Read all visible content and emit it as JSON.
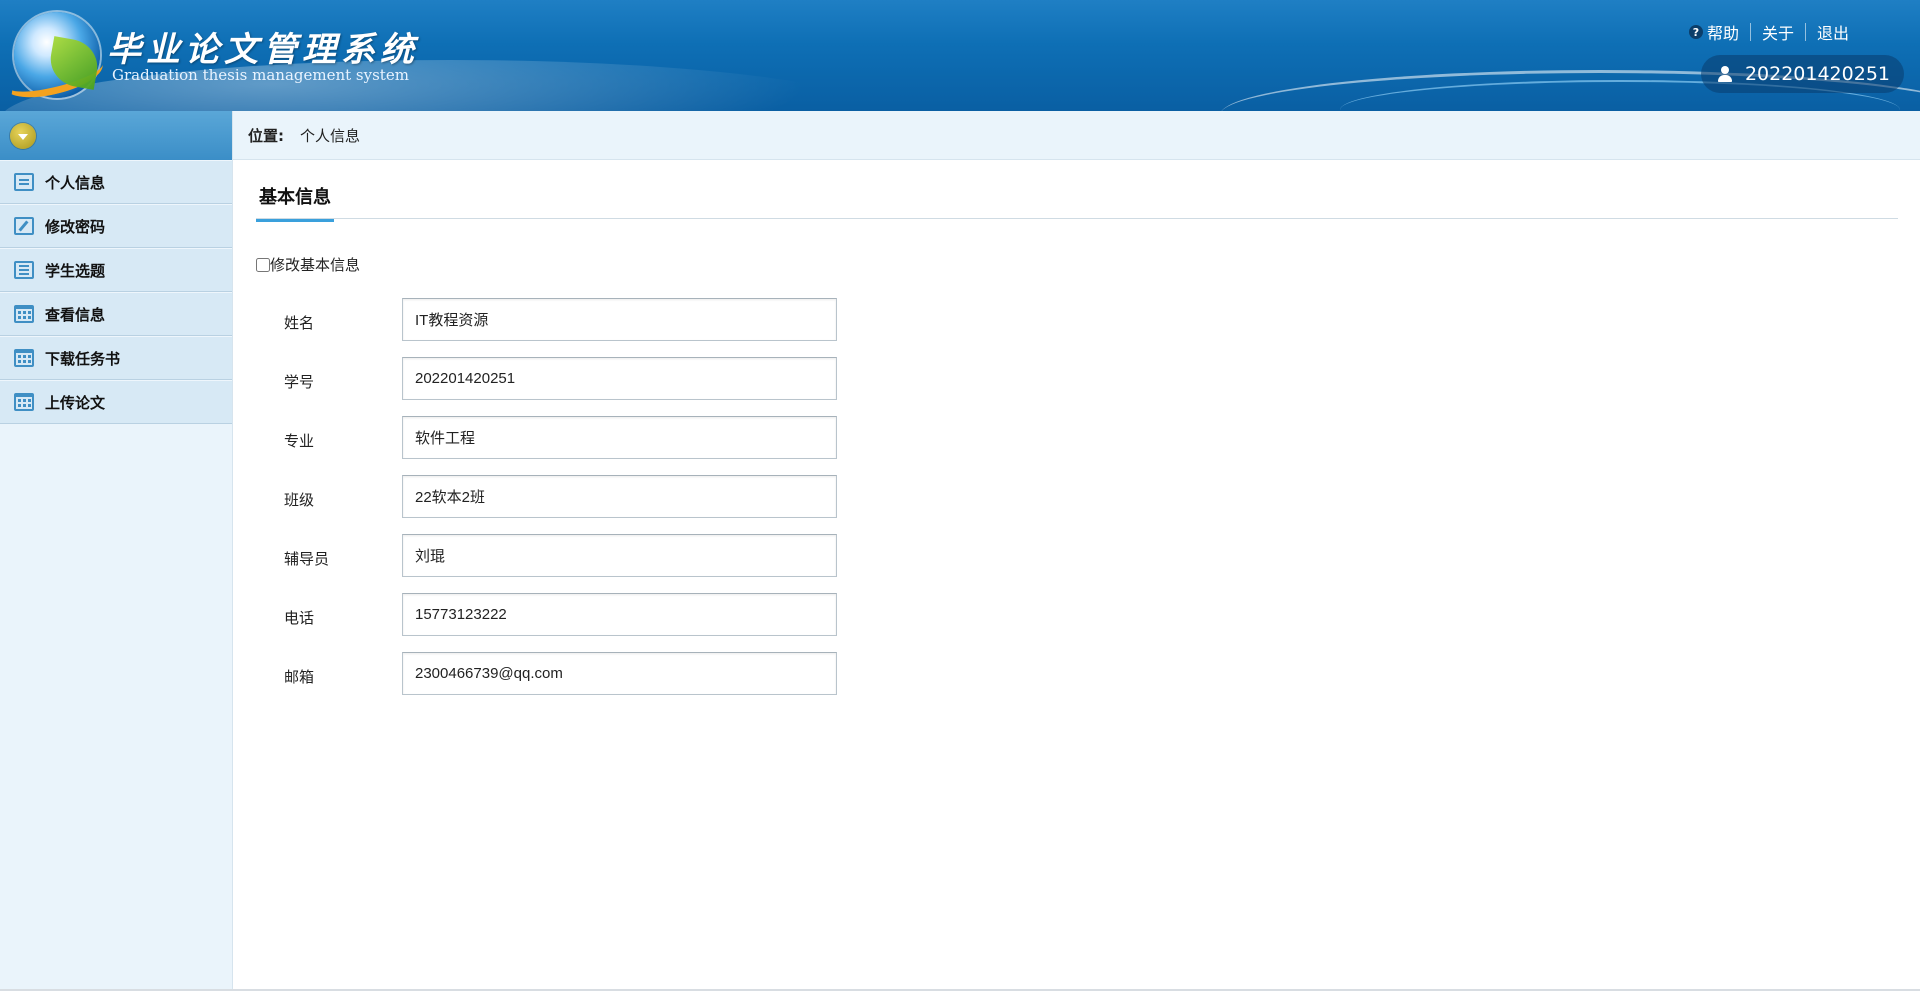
{
  "header": {
    "title": "毕业论文管理系统",
    "subtitle": "Graduation thesis management system",
    "links": {
      "help": "帮助",
      "about": "关于",
      "logout": "退出"
    },
    "help_icon_glyph": "?",
    "username": "202201420251"
  },
  "location": {
    "label": "位置:",
    "current": "个人信息"
  },
  "sidebar": {
    "items": [
      {
        "label": "个人信息",
        "icon": "message-icon"
      },
      {
        "label": "修改密码",
        "icon": "edit-icon"
      },
      {
        "label": "学生选题",
        "icon": "list-icon"
      },
      {
        "label": "查看信息",
        "icon": "calendar-icon"
      },
      {
        "label": "下载任务书",
        "icon": "calendar-icon"
      },
      {
        "label": "上传论文",
        "icon": "calendar-icon"
      }
    ]
  },
  "main": {
    "section_title": "基本信息",
    "edit_checkbox_label": "修改基本信息",
    "edit_checkbox_checked": false,
    "fields": [
      {
        "label": "姓名",
        "value": "IT教程资源"
      },
      {
        "label": "学号",
        "value": "202201420251"
      },
      {
        "label": "专业",
        "value": "软件工程"
      },
      {
        "label": "班级",
        "value": "22软本2班"
      },
      {
        "label": "辅导员",
        "value": "刘琨"
      },
      {
        "label": "电话",
        "value": "15773123222"
      },
      {
        "label": "邮箱",
        "value": "2300466739@qq.com"
      }
    ]
  },
  "colors": {
    "header_blue": "#0e6fb5",
    "accent": "#3aa0dc",
    "sidebar_bg": "#eaf4fb",
    "menu_bg": "#d7e9f5"
  }
}
